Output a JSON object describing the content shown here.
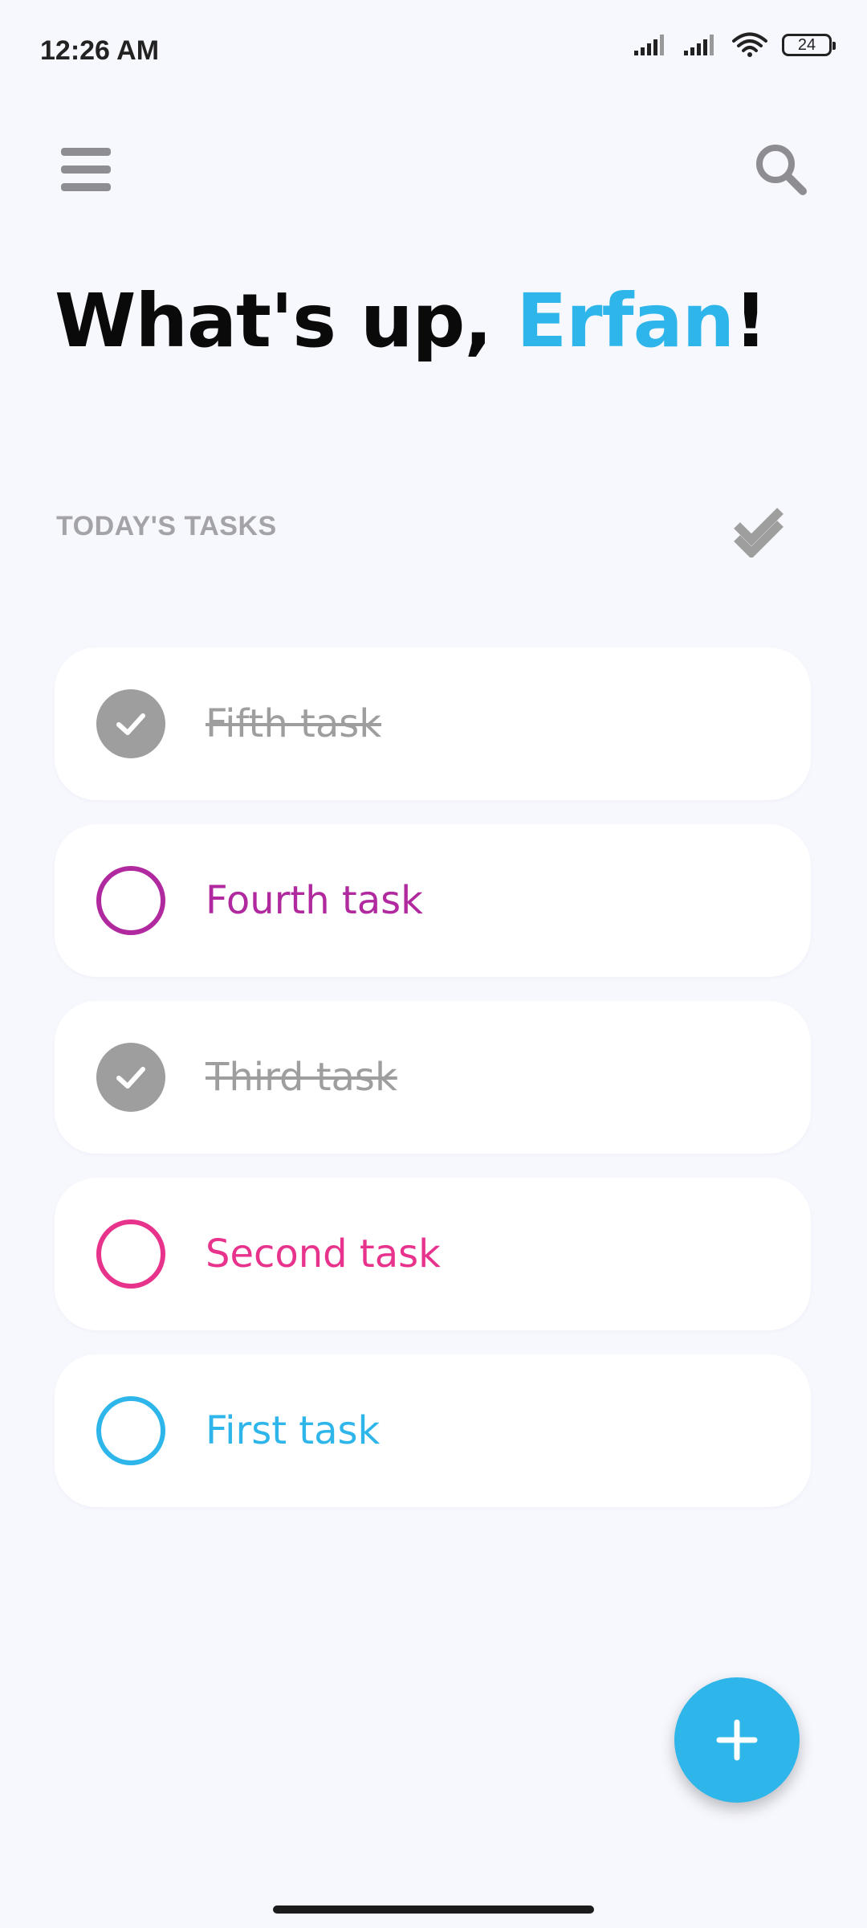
{
  "status_bar": {
    "time": "12:26 AM",
    "battery": "24",
    "icons": [
      "signal-icon",
      "signal-icon",
      "wifi-icon",
      "battery-icon"
    ]
  },
  "header": {
    "menu_icon": "menu-icon",
    "search_icon": "search-icon"
  },
  "greeting": {
    "prefix": "What's up, ",
    "name": "Erfan",
    "suffix": "!"
  },
  "section": {
    "title": "TODAY'S TASKS",
    "action_icon": "double-check-icon"
  },
  "tasks": [
    {
      "label": "Fifth task",
      "done": true,
      "color": "#9e9e9e"
    },
    {
      "label": "Fourth task",
      "done": false,
      "color": "#b0299e"
    },
    {
      "label": "Third task",
      "done": true,
      "color": "#9e9e9e"
    },
    {
      "label": "Second task",
      "done": false,
      "color": "#e8338c"
    },
    {
      "label": "First task",
      "done": false,
      "color": "#2eb6ea"
    }
  ],
  "fab": {
    "icon": "plus-icon"
  },
  "colors": {
    "accent": "#2eb6ea",
    "background": "#f7f8fe",
    "done_gray": "#9e9e9e"
  }
}
